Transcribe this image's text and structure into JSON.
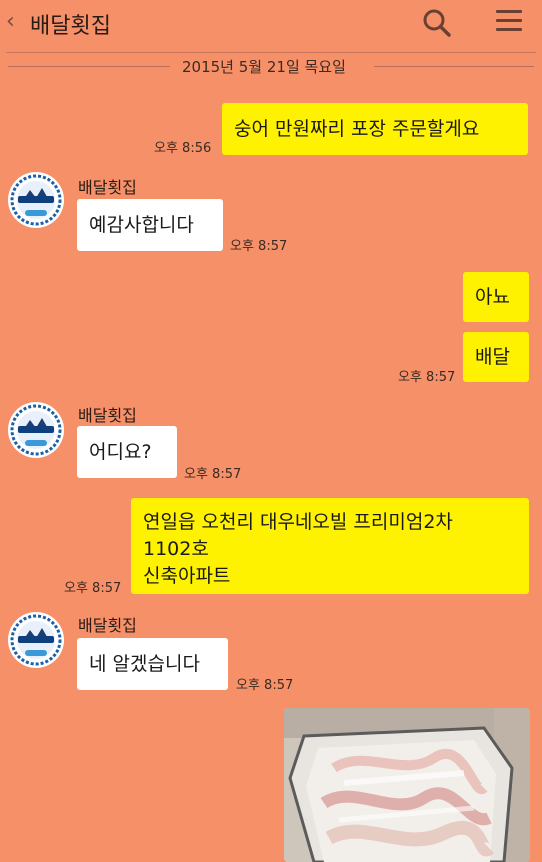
{
  "header": {
    "title": "배달횟집",
    "back_icon": "chevron-left-icon",
    "search_icon": "search-icon",
    "menu_icon": "menu-icon"
  },
  "date_divider": "2015년 5월 21일 목요일",
  "messages": [
    {
      "from": "me",
      "text": "숭어 만원짜리 포장 주문할게요",
      "time": "오후 8:56"
    },
    {
      "from": "them",
      "sender": "배달횟집",
      "text": "예감사합니다",
      "time": "오후 8:57"
    },
    {
      "from": "me",
      "text": "아뇨"
    },
    {
      "from": "me",
      "text": "배달",
      "time": "오후 8:57"
    },
    {
      "from": "them",
      "sender": "배달횟집",
      "text": "어디요?",
      "time": "오후 8:57"
    },
    {
      "from": "me",
      "lines": [
        "연일읍 오천리 대우네오빌 프리미엄2차",
        "1102호",
        "신축아파트"
      ],
      "time": "오후 8:57"
    },
    {
      "from": "them",
      "sender": "배달횟집",
      "text": "네 알겠습니다",
      "time": "오후 8:57"
    },
    {
      "from": "me",
      "type": "photo",
      "description": "sashimi-container-photo"
    }
  ],
  "colors": {
    "background": "#f59069",
    "my_bubble": "#fff200",
    "their_bubble": "#ffffff"
  }
}
